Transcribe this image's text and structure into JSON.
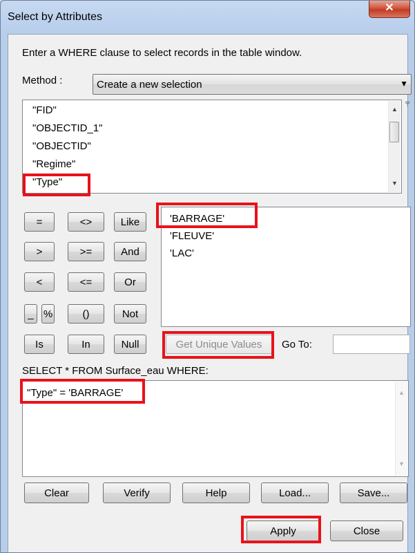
{
  "window": {
    "title": "Select by Attributes",
    "close_glyph": "✕"
  },
  "instruction": "Enter a WHERE clause to select records in the table window.",
  "method": {
    "label": "Method :",
    "selected": "Create a new selection"
  },
  "fields": [
    "\"FID\"",
    "\"OBJECTID_1\"",
    "\"OBJECTID\"",
    "\"Regime\"",
    "\"Type\""
  ],
  "operators": {
    "eq": "=",
    "ne": "<>",
    "like": "Like",
    "gt": ">",
    "ge": ">=",
    "and": "And",
    "lt": "<",
    "le": "<=",
    "or": "Or",
    "underscore": "_",
    "percent": "%",
    "parens": "()",
    "not": "Not",
    "is": "Is",
    "in": "In",
    "null": "Null"
  },
  "unique_values": [
    "'BARRAGE'",
    "'FLEUVE'",
    "'LAC'"
  ],
  "get_unique_values": "Get Unique Values",
  "goto_label": "Go To:",
  "goto_value": "",
  "select_label": "SELECT * FROM Surface_eau WHERE:",
  "expression": "\"Type\" = 'BARRAGE'",
  "buttons": {
    "clear": "Clear",
    "verify": "Verify",
    "help": "Help",
    "load": "Load...",
    "save": "Save...",
    "apply": "Apply",
    "close": "Close"
  },
  "highlight_color": "#e8121a"
}
